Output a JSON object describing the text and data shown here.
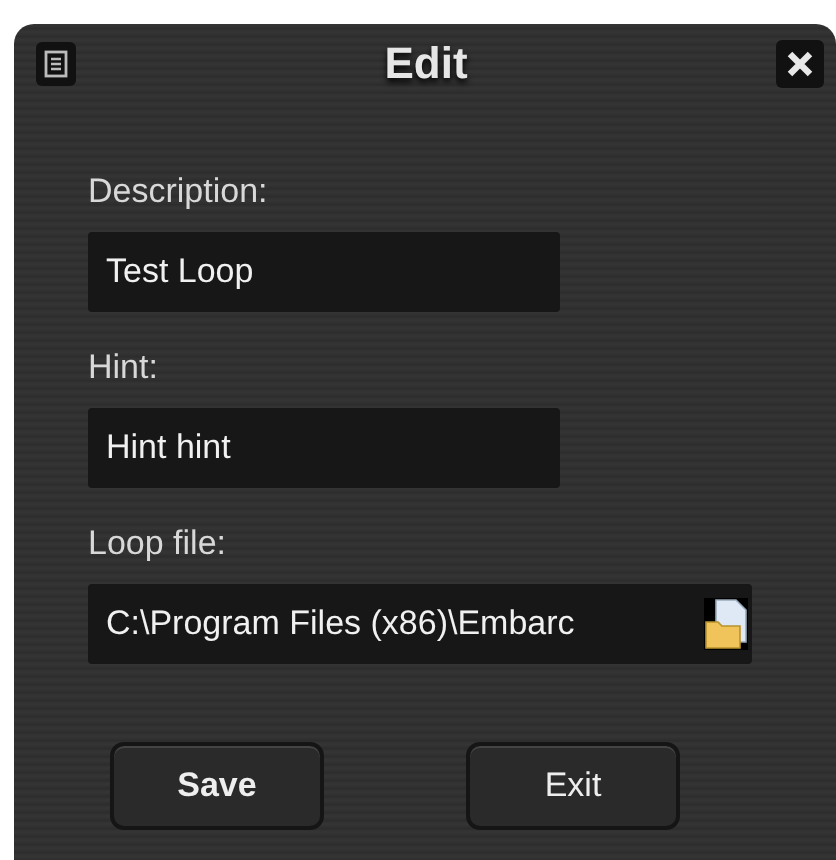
{
  "window": {
    "title": "Edit"
  },
  "fields": [
    {
      "label": "Description:",
      "value": "Test Loop",
      "kind": "text"
    },
    {
      "label": "Hint:",
      "value": "Hint hint",
      "kind": "text"
    },
    {
      "label": "Loop file:",
      "value": "C:\\Program Files (x86)\\Embarc",
      "kind": "file"
    }
  ],
  "buttons": [
    {
      "label": "Save",
      "default": true
    },
    {
      "label": "Exit",
      "default": false
    }
  ]
}
